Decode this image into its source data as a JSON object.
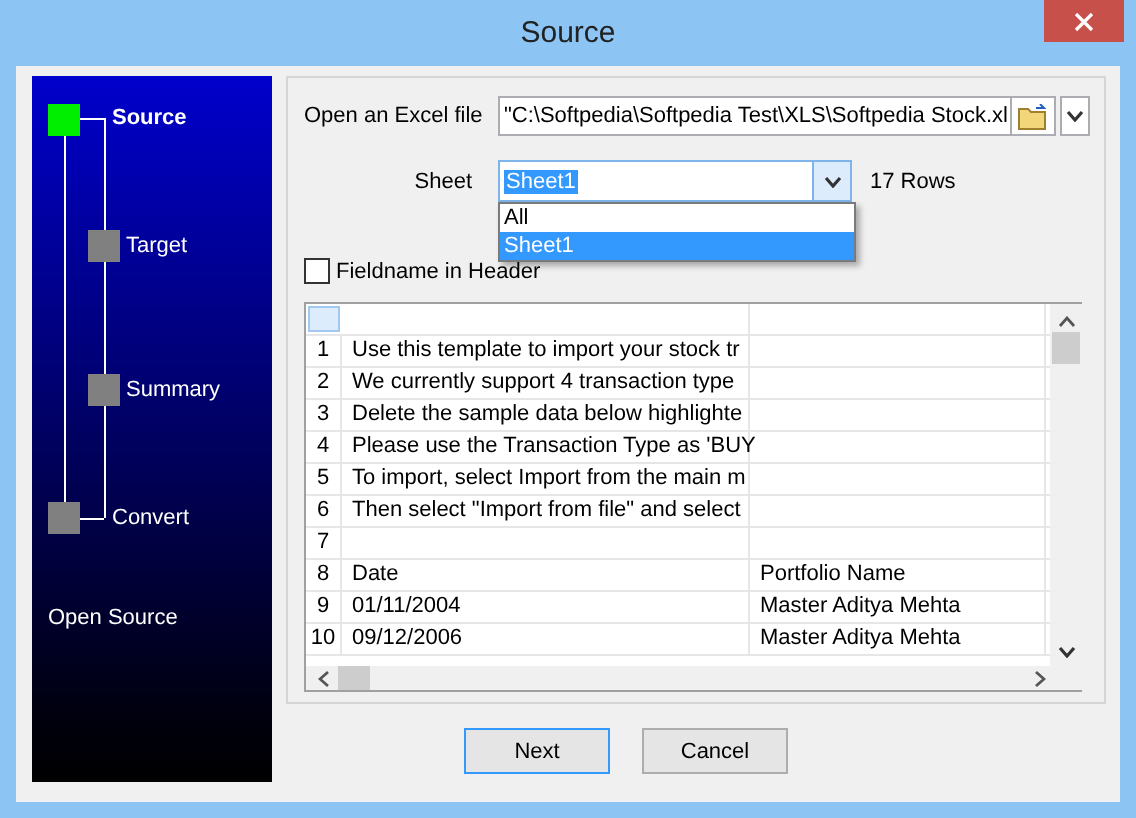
{
  "window": {
    "title": "Source"
  },
  "steps": [
    {
      "label": "Source",
      "selected": true
    },
    {
      "label": "Target",
      "selected": false
    },
    {
      "label": "Summary",
      "selected": false
    },
    {
      "label": "Convert",
      "selected": false
    }
  ],
  "status_text": "Open Source",
  "file": {
    "label": "Open an Excel file",
    "value": "\"C:\\Softpedia\\Softpedia Test\\XLS\\Softpedia Stock.xl"
  },
  "sheet": {
    "label": "Sheet",
    "value": "Sheet1",
    "rows_text": "17 Rows",
    "options": [
      {
        "label": "All",
        "selected": false
      },
      {
        "label": "Sheet1",
        "selected": true
      }
    ]
  },
  "fieldname_checkbox": {
    "label": "Fieldname in Header",
    "checked": false
  },
  "grid": {
    "rows": [
      {
        "number": "1",
        "cells": [
          "Use this template to import your stock tr"
        ]
      },
      {
        "number": "2",
        "cells": [
          "We currently support 4 transaction type"
        ]
      },
      {
        "number": "3",
        "cells": [
          "Delete the sample data below highlighte"
        ]
      },
      {
        "number": "4",
        "cells": [
          "Please use the Transaction Type as 'BUY"
        ]
      },
      {
        "number": "5",
        "cells": [
          "To import, select Import from the main m"
        ]
      },
      {
        "number": "6",
        "cells": [
          "Then select \"Import from file\" and select"
        ]
      },
      {
        "number": "7"
      },
      {
        "number": "8",
        "cells": [
          "Date",
          "Portfolio Name"
        ]
      },
      {
        "number": "9",
        "cells": [
          "01/11/2004",
          "Master Aditya Mehta"
        ]
      },
      {
        "number": "10",
        "cells": [
          "09/12/2006",
          "Master Aditya Mehta"
        ]
      }
    ]
  },
  "buttons": [
    {
      "label": "Next",
      "focused": true
    },
    {
      "label": "Cancel",
      "focused": false
    }
  ]
}
